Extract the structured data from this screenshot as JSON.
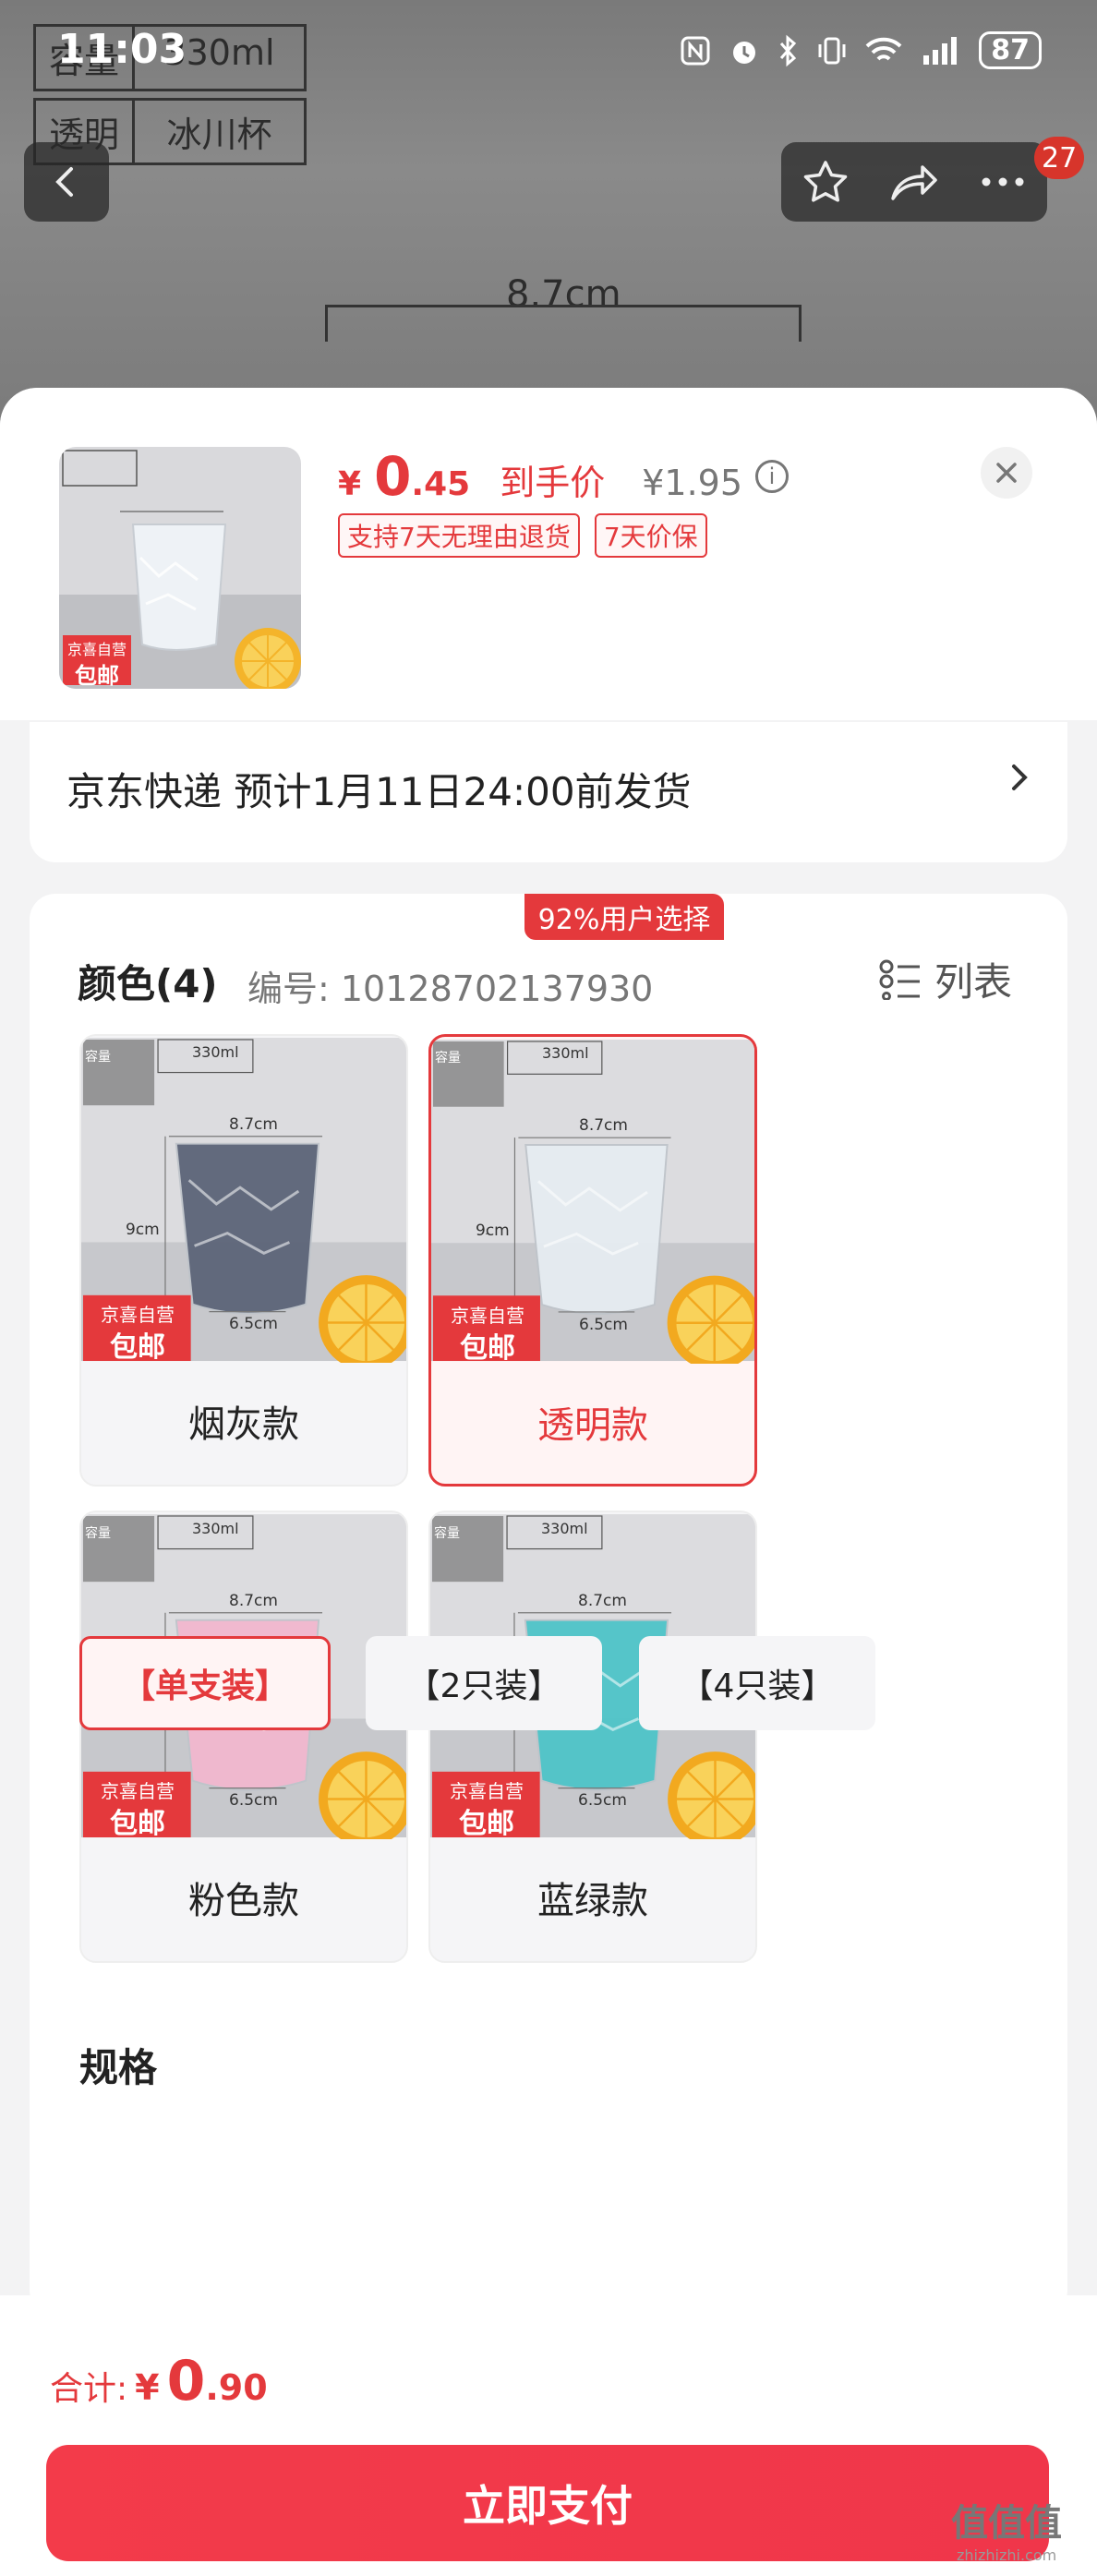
{
  "status_bar": {
    "time": "11:03",
    "battery": "87"
  },
  "background": {
    "spec_rows": [
      {
        "k": "容量",
        "v": "330ml"
      },
      {
        "k": "透明",
        "v": "冰川杯"
      }
    ],
    "dimension_label": "8.7cm",
    "nav_badge": "27",
    "icons": [
      "back-icon",
      "star-icon",
      "share-icon",
      "more-icon"
    ]
  },
  "header": {
    "price_currency": "¥",
    "price_int": "0",
    "price_dec": ".45",
    "price_tag": "到手价",
    "original_price": "¥1.95",
    "tags": [
      "支持7天无理由退货",
      "7天价保"
    ],
    "thumb_label_1": "京喜自营",
    "thumb_label_2": "包邮"
  },
  "delivery": {
    "text": "京东快递 预计1月11日24:00前发货"
  },
  "color_section": {
    "title": "颜色(4)",
    "sku": "编号: 10128702137930",
    "view_toggle": "列表",
    "popular_badge": "92%用户选择",
    "options": [
      {
        "label": "烟灰款",
        "selected": false,
        "glass_color": "#5c6478"
      },
      {
        "label": "透明款",
        "selected": true,
        "glass_color": "#e6ecf1"
      },
      {
        "label": "粉色款",
        "selected": false,
        "glass_color": "#f2b8cf"
      },
      {
        "label": "蓝绿款",
        "selected": false,
        "glass_color": "#4ec4c8"
      }
    ],
    "img_text": {
      "brand": "京喜自营",
      "free": "包邮",
      "width": "8.7cm",
      "height": "9cm",
      "base": "6.5cm",
      "cap": "330ml",
      "cap_label": "容量"
    }
  },
  "size_section": {
    "title": "规格",
    "options": [
      {
        "label": "【单支装】",
        "selected": true
      },
      {
        "label": "【2只装】",
        "selected": false
      },
      {
        "label": "【4只装】",
        "selected": false
      }
    ]
  },
  "footer": {
    "total_label": "合计:",
    "total_currency": "¥",
    "total_int": "0",
    "total_dec": ".90",
    "pay_label": "立即支付"
  },
  "watermark": {
    "main": "值值值",
    "sub": "zhizhizhi.com"
  },
  "colors": {
    "accent": "#e4393c",
    "pay": "#f33b4a"
  }
}
